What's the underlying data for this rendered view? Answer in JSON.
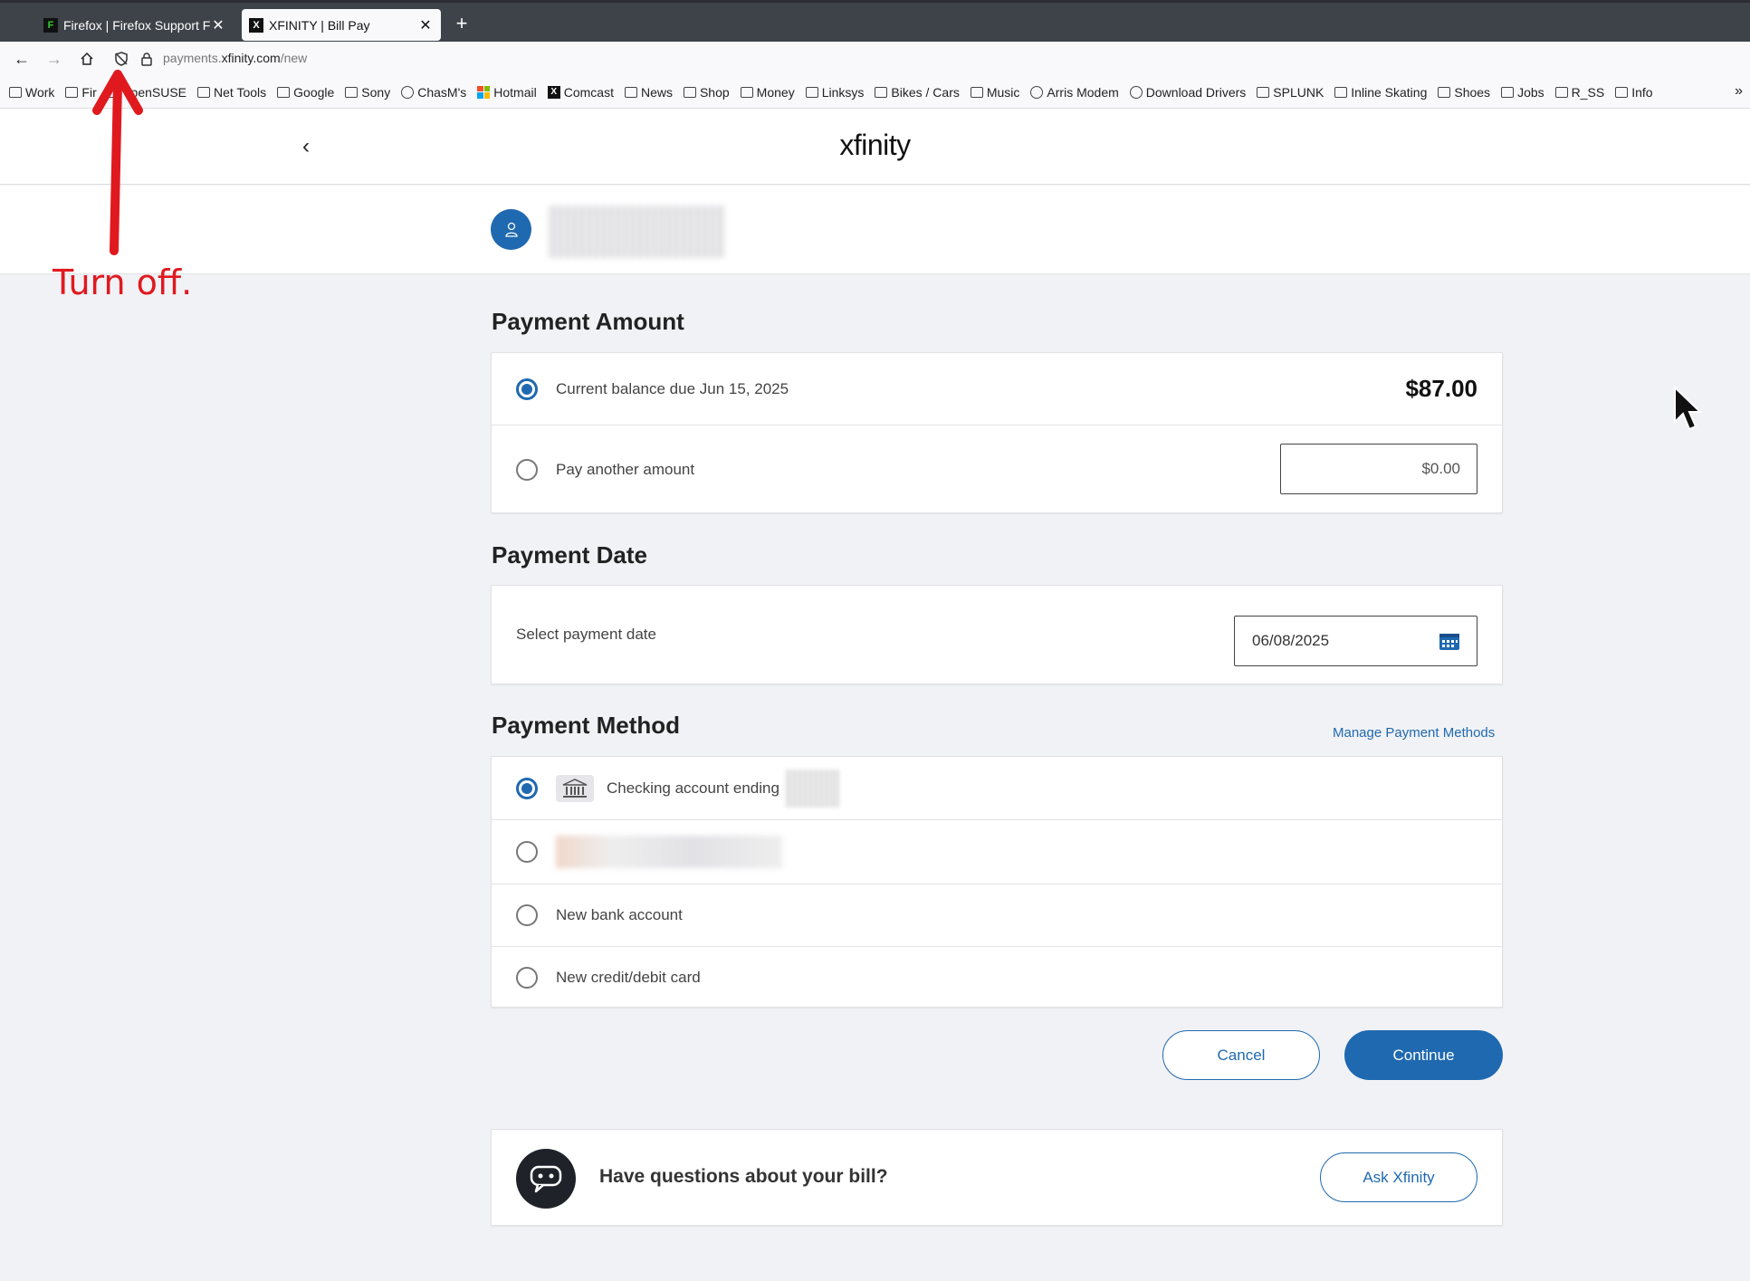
{
  "browser": {
    "tabs": [
      {
        "title": "Firefox | Firefox Support F",
        "active": false
      },
      {
        "title": "XFINITY | Bill Pay",
        "active": true
      }
    ],
    "new_tab": "+",
    "url": {
      "prefix": "payments.",
      "host": "xfinity.com",
      "path": "/new"
    },
    "bookmarks": [
      {
        "label": "Work",
        "icon": "folder"
      },
      {
        "label": "Fir",
        "icon": "folder"
      },
      {
        "label": "openSUSE",
        "icon": "folder"
      },
      {
        "label": "Net Tools",
        "icon": "folder"
      },
      {
        "label": "Google",
        "icon": "folder"
      },
      {
        "label": "Sony",
        "icon": "folder"
      },
      {
        "label": "ChasM's",
        "icon": "globe"
      },
      {
        "label": "Hotmail",
        "icon": "microsoft"
      },
      {
        "label": "Comcast",
        "icon": "x-logo"
      },
      {
        "label": "News",
        "icon": "folder"
      },
      {
        "label": "Shop",
        "icon": "folder"
      },
      {
        "label": "Money",
        "icon": "folder"
      },
      {
        "label": "Linksys",
        "icon": "folder"
      },
      {
        "label": "Bikes / Cars",
        "icon": "folder"
      },
      {
        "label": "Music",
        "icon": "folder"
      },
      {
        "label": "Arris Modem",
        "icon": "globe"
      },
      {
        "label": "Download Drivers",
        "icon": "globe"
      },
      {
        "label": "SPLUNK",
        "icon": "folder"
      },
      {
        "label": "Inline Skating",
        "icon": "folder"
      },
      {
        "label": "Shoes",
        "icon": "folder"
      },
      {
        "label": "Jobs",
        "icon": "folder"
      },
      {
        "label": "R_SS",
        "icon": "folder"
      },
      {
        "label": "Info",
        "icon": "folder"
      }
    ]
  },
  "annotation": {
    "text": "Turn off.",
    "color": "#e0191f"
  },
  "site": {
    "logo": "xfinity",
    "accent": "#1f69b0"
  },
  "payment_amount": {
    "heading": "Payment Amount",
    "balance_label": "Current balance due Jun 15, 2025",
    "balance_value": "$87.00",
    "other_label": "Pay another amount",
    "other_placeholder": "$0.00"
  },
  "payment_date": {
    "heading": "Payment Date",
    "label": "Select payment date",
    "value": "06/08/2025"
  },
  "payment_method": {
    "heading": "Payment Method",
    "manage_link": "Manage Payment Methods",
    "checking_label": "Checking account ending",
    "new_bank": "New bank account",
    "new_card": "New credit/debit card"
  },
  "actions": {
    "cancel": "Cancel",
    "continue": "Continue"
  },
  "help": {
    "question": "Have questions about your bill?",
    "button": "Ask Xfinity"
  }
}
